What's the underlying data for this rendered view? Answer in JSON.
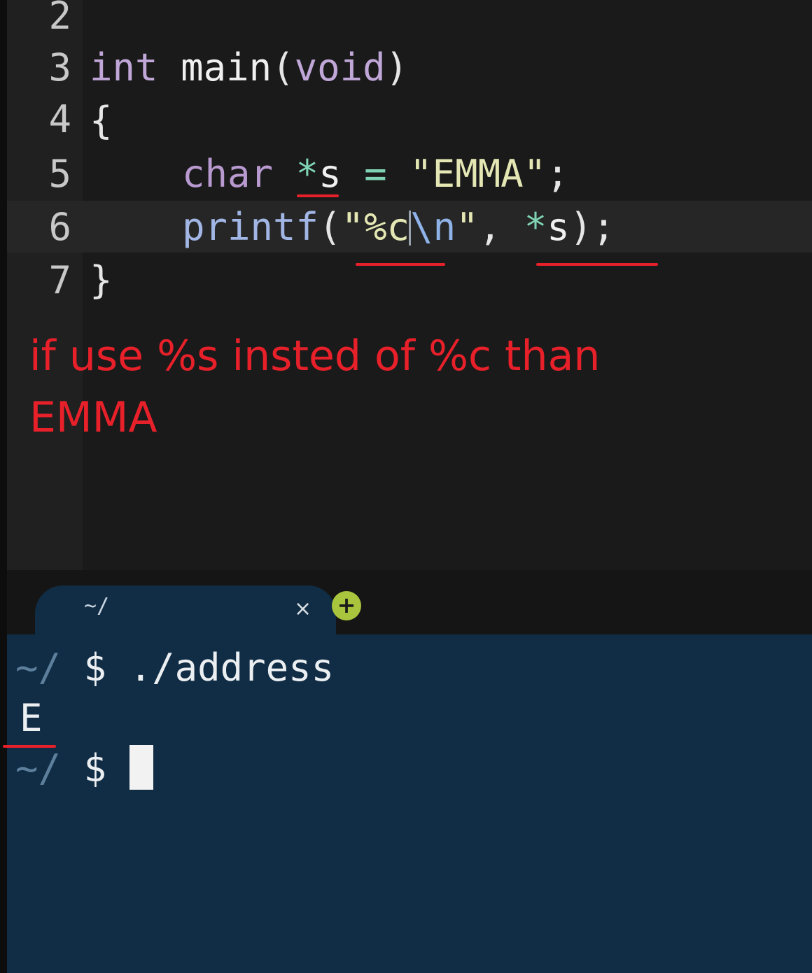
{
  "editor": {
    "line_numbers": [
      "2",
      "3",
      "4",
      "5",
      "6",
      "7"
    ],
    "line3": {
      "type": "int",
      "name": "main",
      "open": "(",
      "param": "void",
      "close": ")"
    },
    "line4": {
      "brace": "{"
    },
    "line5": {
      "type": "char",
      "star": "*",
      "var": "s",
      "eq": "=",
      "value": "\"EMMA\"",
      "semi": ";"
    },
    "line6": {
      "call": "printf",
      "open": "(",
      "fmt_open": "\"%c",
      "fmt_esc": "\\n",
      "fmt_close": "\"",
      "comma": ",",
      "star": "*",
      "arg": "s",
      "end": ");"
    },
    "line7": {
      "brace": "}"
    }
  },
  "annotation": {
    "line1": "if use %s insted of %c than",
    "line2": "EMMA",
    "color": "#e8202a"
  },
  "terminal": {
    "tab_title": "~/",
    "tab_close": "×",
    "add_tab": "+",
    "prompt_dir": "~/",
    "prompt_symbol": "$",
    "command": "./address",
    "output": "E"
  },
  "colors": {
    "editor_bg": "#1a1a1a",
    "terminal_bg": "#102d45",
    "add_button": "#a9c43d"
  }
}
